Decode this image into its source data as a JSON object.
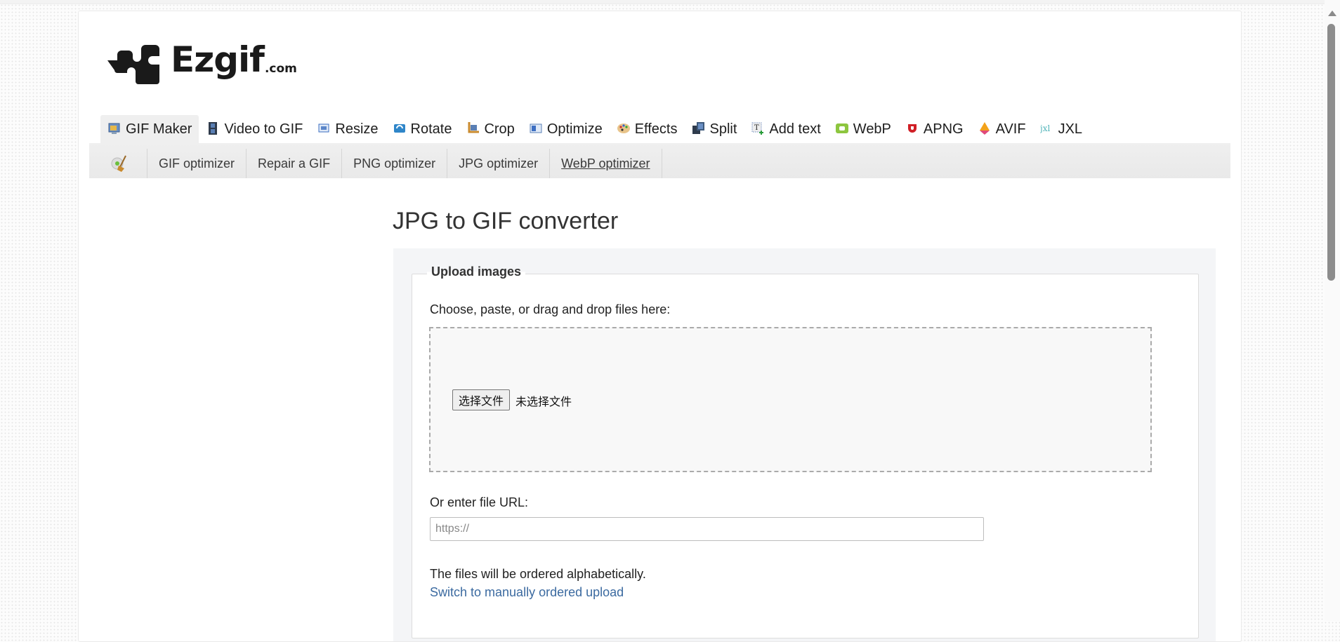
{
  "logo": {
    "name": "Ezgif",
    "tld": ".com"
  },
  "main_nav": [
    {
      "label": "GIF Maker",
      "icon": "gif-maker-icon",
      "active": true
    },
    {
      "label": "Video to GIF",
      "icon": "film-icon",
      "active": false
    },
    {
      "label": "Resize",
      "icon": "resize-icon",
      "active": false
    },
    {
      "label": "Rotate",
      "icon": "rotate-icon",
      "active": false
    },
    {
      "label": "Crop",
      "icon": "crop-icon",
      "active": false
    },
    {
      "label": "Optimize",
      "icon": "optimize-icon",
      "active": false
    },
    {
      "label": "Effects",
      "icon": "palette-icon",
      "active": false
    },
    {
      "label": "Split",
      "icon": "split-icon",
      "active": false
    },
    {
      "label": "Add text",
      "icon": "add-text-icon",
      "active": false
    },
    {
      "label": "WebP",
      "icon": "webp-icon",
      "active": false
    },
    {
      "label": "APNG",
      "icon": "apng-icon",
      "active": false
    },
    {
      "label": "AVIF",
      "icon": "avif-icon",
      "active": false
    },
    {
      "label": "JXL",
      "icon": "jxl-icon",
      "active": false
    }
  ],
  "sub_nav": {
    "icon": "optimize-broom-icon",
    "items": [
      {
        "label": "GIF optimizer"
      },
      {
        "label": "Repair a GIF"
      },
      {
        "label": "PNG optimizer"
      },
      {
        "label": "JPG optimizer"
      },
      {
        "label": "WebP optimizer",
        "underlined": true
      }
    ]
  },
  "page": {
    "title": "JPG to GIF converter",
    "upload": {
      "legend": "Upload images",
      "choose_label": "Choose, paste, or drag and drop files here:",
      "file_button": "选择文件",
      "file_status": "未选择文件",
      "url_label": "Or enter file URL:",
      "url_placeholder": "https://",
      "url_value": "",
      "order_note": "The files will be ordered alphabetically.",
      "switch_link": "Switch to manually ordered upload"
    }
  },
  "colors": {
    "link": "#3b6aa0",
    "panel_bg": "#f4f5f7",
    "nav_active_bg": "#efefef"
  }
}
